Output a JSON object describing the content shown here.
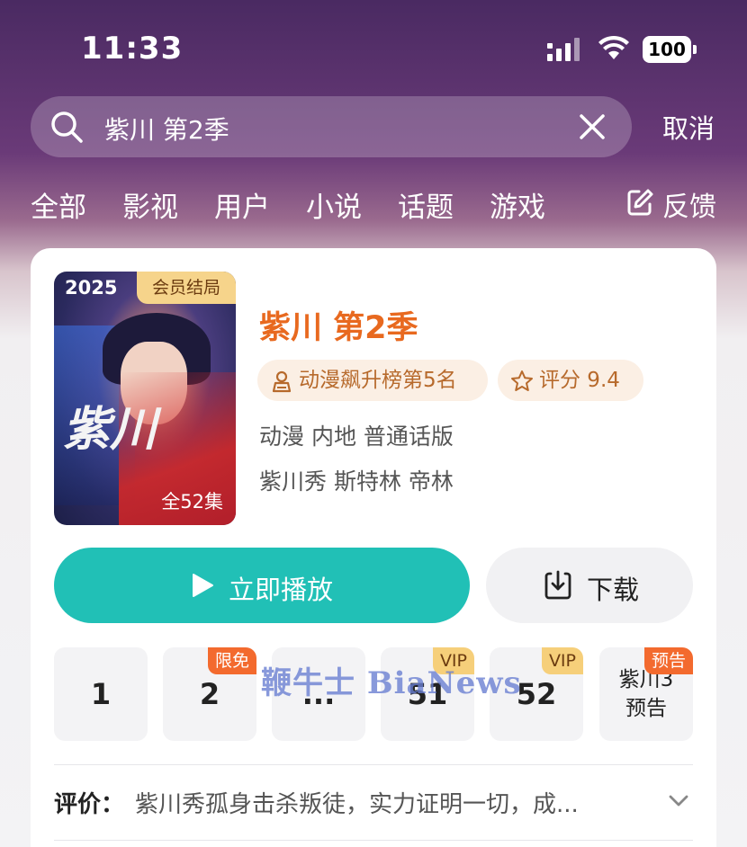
{
  "status_bar": {
    "time": "11:33",
    "battery": "100",
    "icons": [
      "signal-icon",
      "wifi-icon",
      "battery-icon"
    ]
  },
  "search": {
    "value": "紫川 第2季",
    "cancel_label": "取消",
    "icons": [
      "search-icon",
      "clear-icon"
    ]
  },
  "tabs": [
    "全部",
    "影视",
    "用户",
    "小说",
    "话题",
    "游戏"
  ],
  "feedback": {
    "label": "反馈",
    "icon": "edit-icon"
  },
  "result": {
    "poster": {
      "year": "2025",
      "badge": "会员结局",
      "episodes": "全52集",
      "calligraphy": "紫川"
    },
    "title": "紫川 第2季",
    "rank_tag": "动漫飙升榜第5名",
    "score_tag": "评分 9.4",
    "meta_line1": "动漫 内地 普通话版",
    "meta_line2": "紫川秀 斯特林 帝林",
    "play_label": "立即播放",
    "download_label": "下载",
    "episodes": [
      {
        "label": "1",
        "badge": ""
      },
      {
        "label": "2",
        "badge": "限免"
      },
      {
        "label": "...",
        "badge": ""
      },
      {
        "label": "51",
        "badge": "VIP"
      },
      {
        "label": "52",
        "badge": "VIP"
      },
      {
        "label_line1": "紫川3",
        "label_line2": "预告",
        "badge": "预告"
      }
    ],
    "review_label": "评价：",
    "review_text": "紫川秀孤身击杀叛徒，实力证明一切，成..."
  },
  "watermark": "鞭牛士 BiaNews",
  "colors": {
    "accent_title": "#e8691f",
    "play_button": "#21c0b6",
    "tag_bg": "#fbefe4",
    "vip_badge": "#f6cf7a",
    "free_badge": "#f36a2e"
  }
}
